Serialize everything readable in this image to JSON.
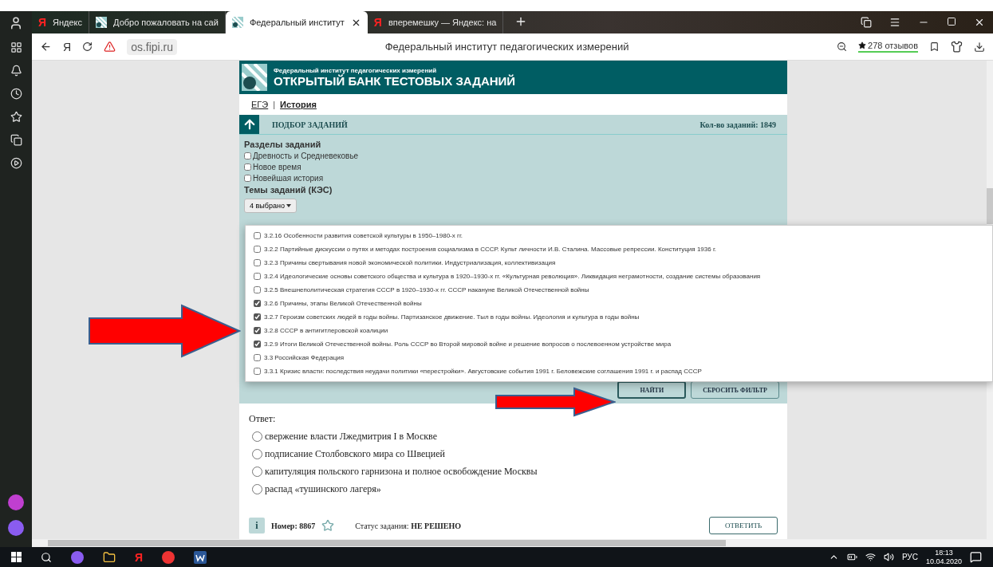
{
  "browser": {
    "tabs": [
      {
        "title": "Яндекс",
        "kind": "yandex",
        "icon": "Я",
        "selected": false
      },
      {
        "title": "Добро пожаловать на сай",
        "kind": "fipi",
        "selected": false
      },
      {
        "title": "Федеральный институт",
        "kind": "fipi",
        "selected": true
      },
      {
        "title": "вперемешку — Яндекс: на",
        "kind": "yandex",
        "icon": "Я",
        "selected": false
      }
    ],
    "home": "Я",
    "address": "os.fipi.ru",
    "page_title": "Федеральный институт педагогических измерений",
    "reviews": "278 отзывов"
  },
  "site": {
    "org": "Федеральный институт педагогических измерений",
    "title": "ОТКРЫТЫЙ БАНК ТЕСТОВЫХ ЗАДАНИЙ"
  },
  "breadcrumb": {
    "items": [
      "ЕГЭ",
      "История"
    ],
    "separator": "|"
  },
  "filter": {
    "title": "ПОДБОР ЗАДАНИЙ",
    "count": "Кол-во заданий: 1849",
    "sections_label": "Разделы заданий",
    "sections": [
      {
        "label": "Древность и Средневековье",
        "checked": false
      },
      {
        "label": "Новое время",
        "checked": false
      },
      {
        "label": "Новейшая история",
        "checked": false
      }
    ],
    "topics_label": "Темы заданий (КЭС)",
    "dropdown": "4 выбрано",
    "topics": [
      {
        "label": "3.2.16 Особенности развития советской культуры в 1950–1980-х гг.",
        "checked": false
      },
      {
        "label": "3.2.2 Партийные дискуссии о путях и методах построения социализма в СССР. Культ личности И.В. Сталина. Массовые репрессии. Конституция 1936 г.",
        "checked": false
      },
      {
        "label": "3.2.3 Причины свертывания новой экономической политики. Индустриализация, коллективизация",
        "checked": false
      },
      {
        "label": "3.2.4 Идеологические основы советского общества и культура в 1920–1930-х гг. «Культурная революция». Ликвидация неграмотности, создание системы образования",
        "checked": false
      },
      {
        "label": "3.2.5 Внешнеполитическая стратегия СССР в 1920–1930-х гг. СССР накануне Великой Отечественной войны",
        "checked": false
      },
      {
        "label": "3.2.6 Причины, этапы Великой Отечественной войны",
        "checked": true
      },
      {
        "label": "3.2.7 Героизм советских людей в годы войны. Партизанское движение. Тыл в годы войны. Идеология и культура в годы войны",
        "checked": true
      },
      {
        "label": "3.2.8 СССР в антигитлеровской коалиции",
        "checked": true
      },
      {
        "label": "3.2.9 Итоги Великой Отечественной войны. Роль СССР во Второй мировой войне и решение вопросов о послевоенном устройстве мира",
        "checked": true
      },
      {
        "label": "3.3 Российская Федерация",
        "checked": false
      },
      {
        "label": "3.3.1 Кризис власти: последствия неудачи политики «перестройки». Августовские события 1991 г. Беловежские соглашения 1991 г. и распад СССР",
        "checked": false
      }
    ],
    "buttons": [
      "НАЙТИ",
      "СБРОСИТЬ ФИЛЬТР"
    ]
  },
  "task": {
    "answer_label": "Ответ:",
    "options": [
      {
        "label": "свержение власти Лжедмитрия I в Москве",
        "selected": false
      },
      {
        "label": "подписание Столбовского мира со Швецией",
        "selected": false
      },
      {
        "label": "капитуляция польского гарнизона и полное освобождение Москвы",
        "selected": false
      },
      {
        "label": "распад «тушинского лагеря»",
        "selected": false
      }
    ],
    "info": "i",
    "number_label": "Номер:",
    "number": "8867",
    "status_label": "Статус задания:",
    "status": "НЕ РЕШЕНО",
    "answer_button": "ОТВЕТИТЬ"
  },
  "taskbar": {
    "yandex": "Я",
    "lang": "РУС",
    "time": "18:13",
    "date": "10.04.2020"
  }
}
